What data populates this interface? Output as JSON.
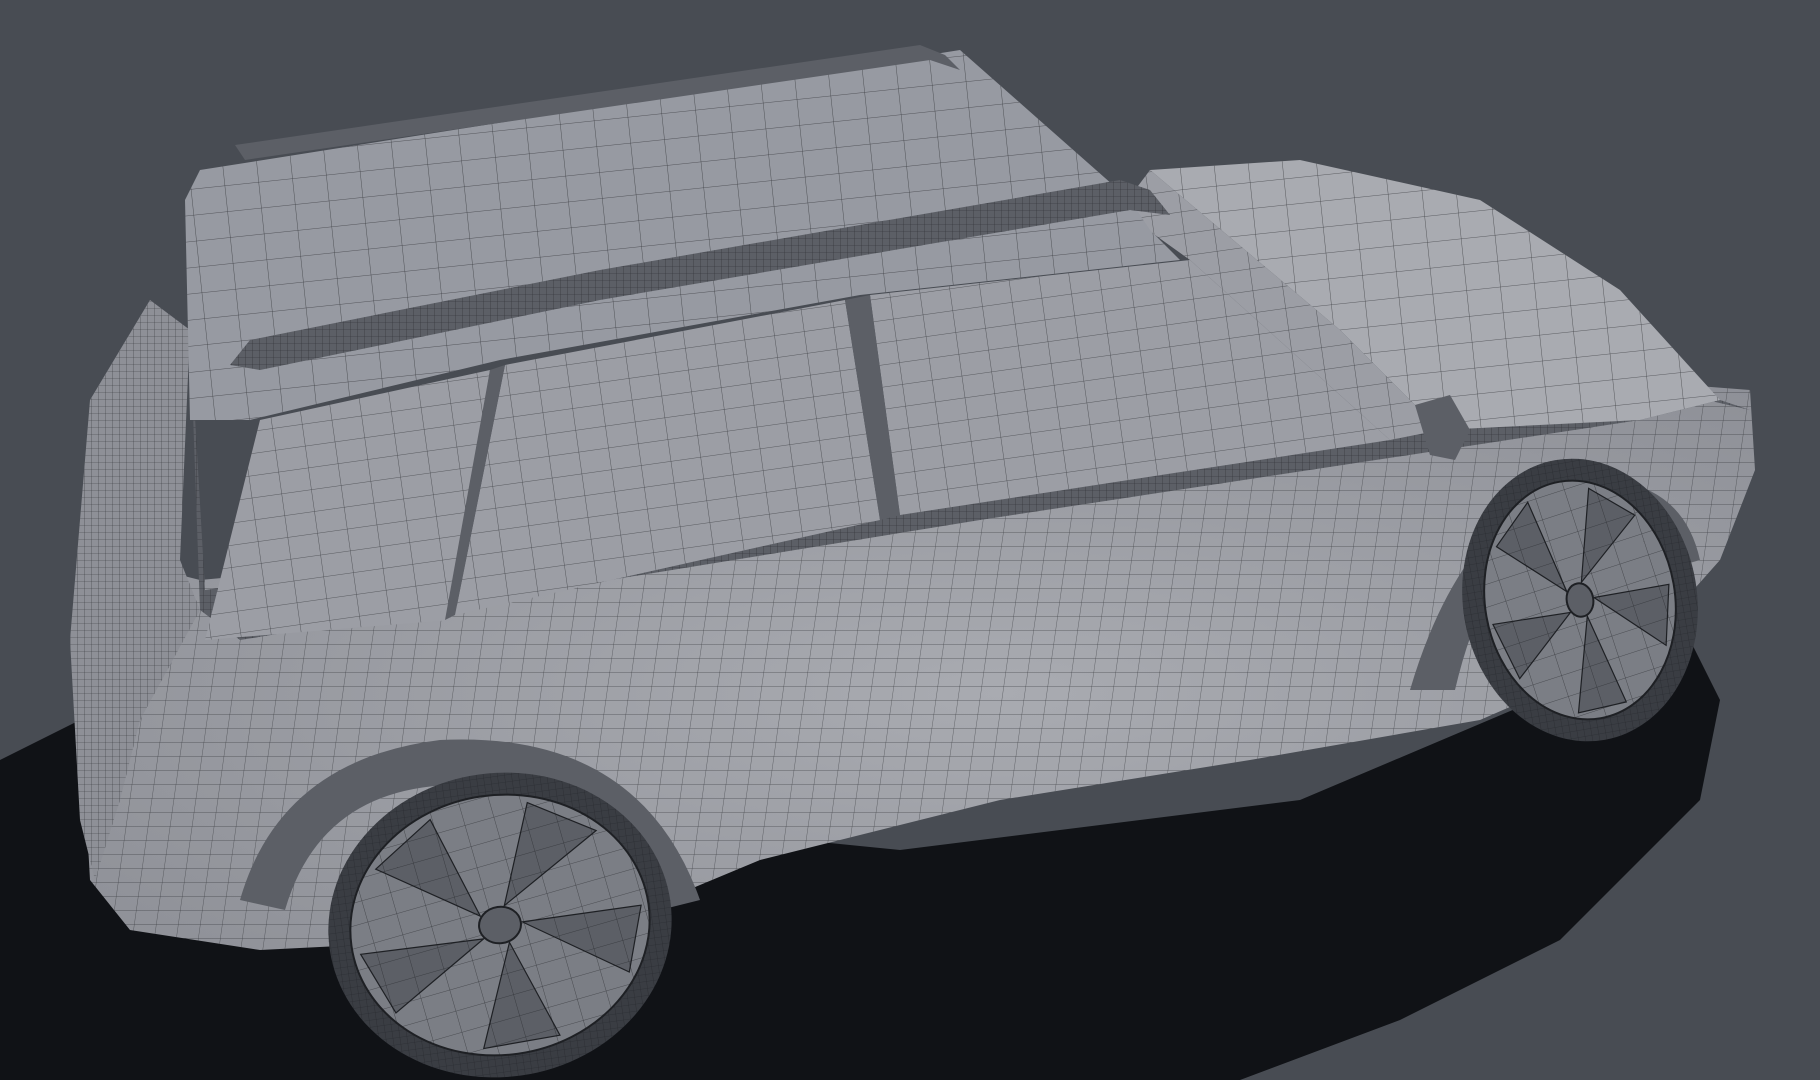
{
  "scene": {
    "subject_icon": "car-wireframe-icon",
    "colors": {
      "background": "#484c53",
      "shadow": "#101216",
      "body": "#8e9097",
      "body_light": "#a9abb1",
      "glass": "#9c9ea5",
      "roof": "#979aa2",
      "trim": "#5c5f66",
      "wire": "#1e2024",
      "wheel": "#7b7e85",
      "tire": "#3a3d43"
    }
  }
}
